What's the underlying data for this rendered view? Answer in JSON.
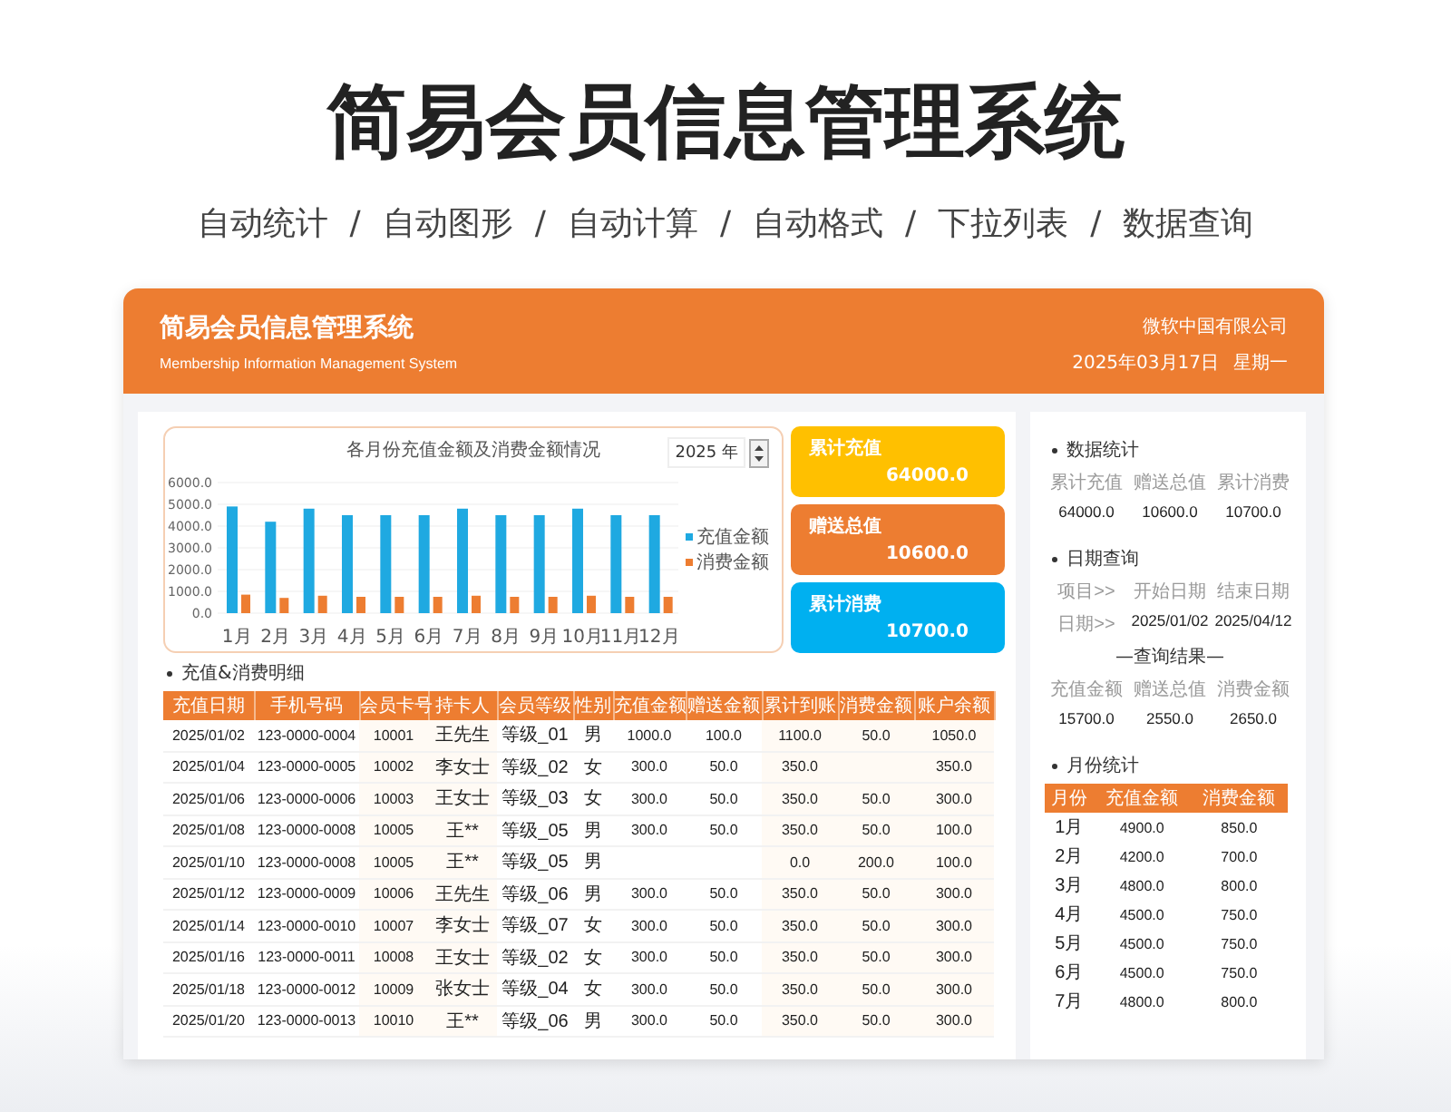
{
  "page_title": "简易会员信息管理系统",
  "features": [
    "自动统计",
    "自动图形",
    "自动计算",
    "自动格式",
    "下拉列表",
    "数据查询"
  ],
  "separator": "/",
  "header": {
    "title": "简易会员信息管理系统",
    "subtitle": "Membership Information Management System",
    "company": "微软中国有限公司",
    "date": "2025年03月17日",
    "weekday": "星期一"
  },
  "chart": {
    "year": "2025 年",
    "chart_data": {
      "type": "bar",
      "title": "各月份充值金额及消费金额情况",
      "categories": [
        "1月",
        "2月",
        "3月",
        "4月",
        "5月",
        "6月",
        "7月",
        "8月",
        "9月",
        "10月",
        "11月",
        "12月"
      ],
      "series": [
        {
          "name": "充值金额",
          "color": "#1fa9e1",
          "values": [
            4900,
            4200,
            4800,
            4500,
            4500,
            4500,
            4800,
            4500,
            4500,
            4800,
            4500,
            4500
          ]
        },
        {
          "name": "消费金额",
          "color": "#ed7d31",
          "values": [
            850,
            700,
            800,
            750,
            750,
            750,
            800,
            750,
            750,
            800,
            750,
            750
          ]
        }
      ],
      "grid": true,
      "legend": true,
      "ylim": [
        0,
        6000
      ],
      "yticks": [
        {
          "value": 0,
          "label": "0.0"
        },
        {
          "value": 1000,
          "label": "1000.0"
        },
        {
          "value": 2000,
          "label": "2000.0"
        },
        {
          "value": 3000,
          "label": "3000.0"
        },
        {
          "value": 4000,
          "label": "4000.0"
        },
        {
          "value": 5000,
          "label": "5000.0"
        },
        {
          "value": 6000,
          "label": "6000.0"
        }
      ]
    }
  },
  "kpis": [
    {
      "label": "累计充值",
      "value": "64000.0",
      "color": "#ffc000"
    },
    {
      "label": "赠送总值",
      "value": "10600.0",
      "color": "#ed7d31"
    },
    {
      "label": "累计消费",
      "value": "10700.0",
      "color": "#00b0f0"
    }
  ],
  "details": {
    "heading": "充值&消费明细",
    "columns": [
      "充值日期",
      "手机号码",
      "会员卡号",
      "持卡人",
      "会员等级",
      "性别",
      "充值金额",
      "赠送金额",
      "累计到账",
      "消费金额",
      "账户余额"
    ],
    "rows": [
      [
        "2025/01/02",
        "123-0000-0004",
        "10001",
        "王先生",
        "等级_01",
        "男",
        "1000.0",
        "100.0",
        "1100.0",
        "50.0",
        "1050.0"
      ],
      [
        "2025/01/04",
        "123-0000-0005",
        "10002",
        "李女士",
        "等级_02",
        "女",
        "300.0",
        "50.0",
        "350.0",
        "",
        "350.0"
      ],
      [
        "2025/01/06",
        "123-0000-0006",
        "10003",
        "王女士",
        "等级_03",
        "女",
        "300.0",
        "50.0",
        "350.0",
        "50.0",
        "300.0"
      ],
      [
        "2025/01/08",
        "123-0000-0008",
        "10005",
        "王**",
        "等级_05",
        "男",
        "300.0",
        "50.0",
        "350.0",
        "50.0",
        "100.0"
      ],
      [
        "2025/01/10",
        "123-0000-0008",
        "10005",
        "王**",
        "等级_05",
        "男",
        "",
        "",
        "0.0",
        "200.0",
        "100.0"
      ],
      [
        "2025/01/12",
        "123-0000-0009",
        "10006",
        "王先生",
        "等级_06",
        "男",
        "300.0",
        "50.0",
        "350.0",
        "50.0",
        "300.0"
      ],
      [
        "2025/01/14",
        "123-0000-0010",
        "10007",
        "李女士",
        "等级_07",
        "女",
        "300.0",
        "50.0",
        "350.0",
        "50.0",
        "300.0"
      ],
      [
        "2025/01/16",
        "123-0000-0011",
        "10008",
        "王女士",
        "等级_02",
        "女",
        "300.0",
        "50.0",
        "350.0",
        "50.0",
        "300.0"
      ],
      [
        "2025/01/18",
        "123-0000-0012",
        "10009",
        "张女士",
        "等级_04",
        "女",
        "300.0",
        "50.0",
        "350.0",
        "50.0",
        "300.0"
      ],
      [
        "2025/01/20",
        "123-0000-0013",
        "10010",
        "王**",
        "等级_06",
        "男",
        "300.0",
        "50.0",
        "350.0",
        "50.0",
        "300.0"
      ]
    ]
  },
  "stats": {
    "heading": "数据统计",
    "labels": [
      "累计充值",
      "赠送总值",
      "累计消费"
    ],
    "values": [
      "64000.0",
      "10600.0",
      "10700.0"
    ]
  },
  "date_query": {
    "heading": "日期查询",
    "col_labels": [
      "项目>>",
      "开始日期",
      "结束日期"
    ],
    "row_label": "日期>>",
    "start": "2025/01/02",
    "end": "2025/04/12",
    "result_title": "—查询结果—",
    "result_labels": [
      "充值金额",
      "赠送总值",
      "消费金额"
    ],
    "result_values": [
      "15700.0",
      "2550.0",
      "2650.0"
    ]
  },
  "month_stats": {
    "heading": "月份统计",
    "columns": [
      "月份",
      "充值金额",
      "消费金额"
    ],
    "rows": [
      [
        "1月",
        "4900.0",
        "850.0"
      ],
      [
        "2月",
        "4200.0",
        "700.0"
      ],
      [
        "3月",
        "4800.0",
        "800.0"
      ],
      [
        "4月",
        "4500.0",
        "750.0"
      ],
      [
        "5月",
        "4500.0",
        "750.0"
      ],
      [
        "6月",
        "4500.0",
        "750.0"
      ],
      [
        "7月",
        "4800.0",
        "800.0"
      ]
    ]
  }
}
